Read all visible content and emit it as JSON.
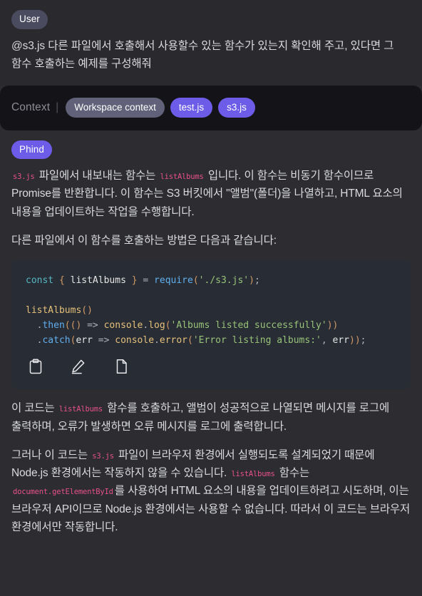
{
  "user": {
    "badge_label": "User",
    "message_mention": "@s3.js",
    "message_body": " 다른 파일에서 호출해서 사용할수 있는 함수가 있는지 확인해 주고, 있다면 그 함수 호출하는 예제를 구성해줘"
  },
  "context": {
    "label": "Context",
    "separator": "|",
    "chips": [
      {
        "name": "Workspace context",
        "type": "workspace"
      },
      {
        "name": "test.js",
        "type": "file"
      },
      {
        "name": "s3.js",
        "type": "file"
      }
    ]
  },
  "assistant": {
    "badge_label": "Phind",
    "paragraph1": {
      "code1": "s3.js",
      "text1": " 파일에서 내보내는 함수는 ",
      "code2": "listAlbums",
      "text2": " 입니다. 이 함수는 비동기 함수이므로 Promise를 반환합니다. 이 함수는 S3 버킷에서 \"앨범\"(폴더)을 나열하고, HTML 요소의 내용을 업데이트하는 작업을 수행합니다."
    },
    "paragraph2": "다른 파일에서 이 함수를 호출하는 방법은 다음과 같습니다:",
    "paragraph3": {
      "text1": "이 코드는 ",
      "code1": "listAlbums",
      "text2": " 함수를 호출하고, 앨범이 성공적으로 나열되면 메시지를 로그에 출력하며, 오류가 발생하면 오류 메시지를 로그에 출력합니다."
    },
    "paragraph4": {
      "text1": "그러나 이 코드는 ",
      "code1": "s3.js",
      "text2": " 파일이 브라우저 환경에서 실행되도록 설계되었기 때문에 Node.js 환경에서는 작동하지 않을 수 있습니다. ",
      "code2": "listAlbums",
      "text3": " 함수는 ",
      "code3": "document.getElementById",
      "text4": "를 사용하여 HTML 요소의 내용을 업데이트하려고 시도하며, 이는 브라우저 API이므로 Node.js 환경에서는 사용할 수 없습니다. 따라서 이 코드는 브라우저 환경에서만 작동합니다."
    }
  },
  "code_block": {
    "language": "javascript",
    "lines": [
      "const { listAlbums } = require('./s3.js');",
      "",
      "listAlbums()",
      "  .then(() => console.log('Albums listed successfully'))",
      "  .catch(err => console.error('Error listing albums:', err));"
    ],
    "actions": [
      {
        "name": "copy",
        "icon": "clipboard-icon"
      },
      {
        "name": "edit",
        "icon": "pencil-icon"
      },
      {
        "name": "new-file",
        "icon": "file-icon"
      }
    ]
  },
  "colors": {
    "page_background": "#2d2d31",
    "user_background": "#2a2a2e",
    "context_background": "#141418",
    "code_background": "#282c34",
    "accent_purple": "#6c5ce7",
    "chip_workspace": "#61617a",
    "badge_user": "#4b4b60",
    "inline_code": "#e5508a",
    "body_text": "#d9dade"
  }
}
